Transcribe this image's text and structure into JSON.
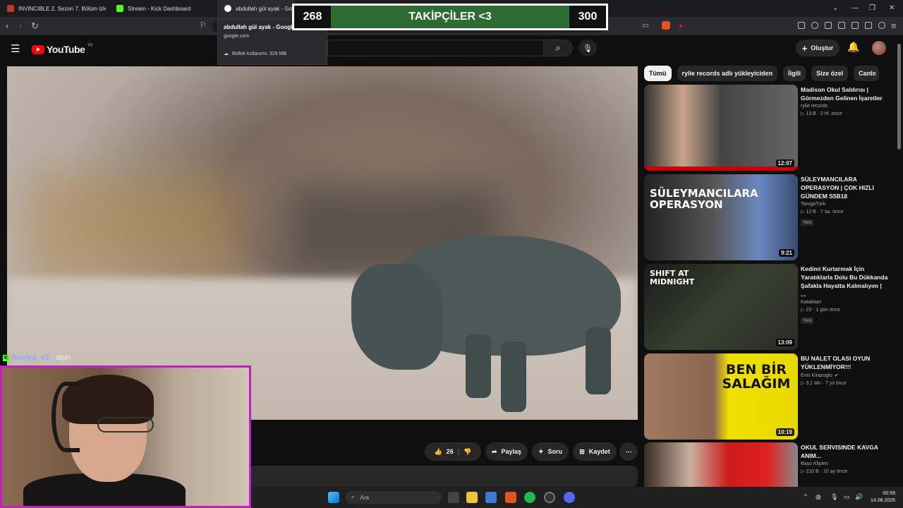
{
  "browser": {
    "tabs": [
      {
        "title": "INVINCIBLE 2. Sezon 7. Bölüm izle",
        "favicon_color": "#c0392b"
      },
      {
        "title": "Stream - Kick Dashboard",
        "favicon_color": "#53fc18"
      },
      {
        "title": "abdullah gül ayak - Google",
        "favicon_color": "#ffffff"
      }
    ],
    "tooltip": {
      "title": "abdullah gül ayak - Google",
      "domain": "google.com",
      "memory": "Bellek kullanımı: 329 MB"
    }
  },
  "overlay": {
    "left": "268",
    "label": "TAKİPÇİLER <3",
    "right": "300",
    "bar_color": "#2e6b33"
  },
  "youtube": {
    "logo_text": "YouTube",
    "region": "TR",
    "create_label": "Oluştur",
    "actions": {
      "likes": "26",
      "share": "Paylaş",
      "ask": "Soru",
      "save": "Kaydet"
    },
    "chips": [
      "Tümü",
      "rylie records adlı yükleyiciden",
      "İlgili",
      "Size özel",
      "Canlı"
    ],
    "recommendations": [
      {
        "title": "Madison Okul Saldırısı | Görmezden Gelinen İşaretler",
        "channel": "rylie records",
        "meta": "▷ 13 B · 2 hf. önce",
        "duration": "12:07",
        "badge": "",
        "verified": false,
        "thumb_text": ""
      },
      {
        "title": "SÜLEYMANCILARA OPERASYON | ÇOK HIZLI GÜNDEM S5B18",
        "channel": "TamgaTürk",
        "meta": "▷ 12 B · 7 sa. önce",
        "duration": "9:21",
        "badge": "Yeni",
        "verified": false,
        "thumb_text": "SÜLEYMANCILARA OPERASYON"
      },
      {
        "title": "Kedimi Kurtarmak İçin Yaratıklarla Dolu Bu Dükkanda Şafakla Hayatta Kalmalıyım | ...",
        "channel": "Katakitari",
        "meta": "▷ 23 · 1 gün önce",
        "duration": "13:09",
        "badge": "Yeni",
        "verified": false,
        "thumb_text": "SHIFT AT MIDNIGHT"
      },
      {
        "title": "BU NALET OLASI OYUN YÜKLENMİYOR!!!",
        "channel": "Enis Kirazoglu",
        "meta": "▷ 3,1 Mn · 7 yıl önce",
        "duration": "10:19",
        "badge": "",
        "verified": true,
        "thumb_text": "BEN BİR SALAĞIM"
      },
      {
        "title": "OKUL SERVISINDE KAVGA ANIM...",
        "channel": "Başo Klipleri",
        "meta": "▷ 210 B · 10 ay önce",
        "duration": "",
        "badge": "",
        "verified": false,
        "thumb_text": ""
      }
    ]
  },
  "stream": {
    "chat_user": "Acelya_v2",
    "chat_message": ": aşırı"
  },
  "taskbar": {
    "search_placeholder": "Ara",
    "time": "00:59",
    "date": "14.08.2026"
  }
}
